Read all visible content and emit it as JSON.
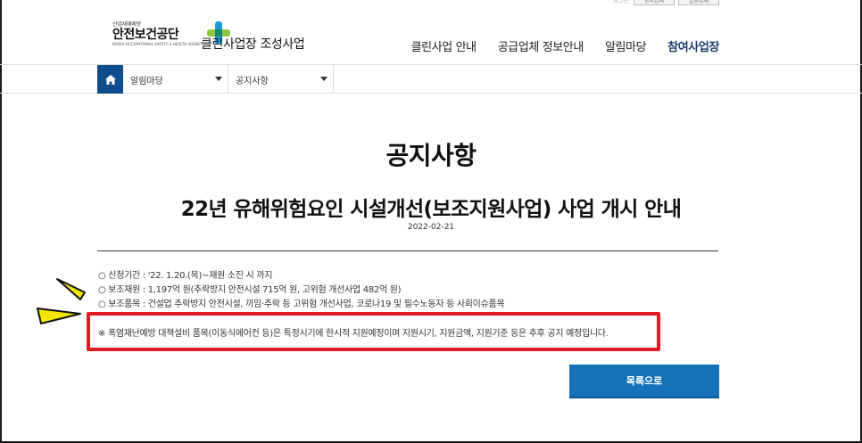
{
  "top_util": {
    "items": [
      "공지업체",
      "알림업체"
    ],
    "dim": "로그인"
  },
  "header": {
    "logo_small": "산업재해예방",
    "logo_big": "안전보건공단",
    "logo_eng": "KOREA OCCUPATIONAL SAFETY & HEALTH AGENCY",
    "site_name": "클린사업장 조성사업"
  },
  "gnb": {
    "items": [
      "클린사업 안내",
      "공급업체 정보안내",
      "알림마당",
      "참여사업장"
    ]
  },
  "breadcrumb": {
    "level1": "알림마당",
    "level2": "공지사항"
  },
  "page": {
    "title": "공지사항"
  },
  "post": {
    "title": "22년 유해위험요인 시설개선(보조지원사업) 사업 개시 안내",
    "date": "2022-02-21",
    "lines": [
      "○ 신청기간 : '22. 1.20.(목)~재원 소진 시 까지",
      "○ 보조재원 : 1,197억 원(추락방지 안전시설 715억 원, 고위험 개선사업 482억 원)",
      "○ 보조품목 : 건설업 추락방지 안전시설, 끼임·추락 등 고위험 개선사업, 코로나19 및 필수노동자 등 사회이슈품목"
    ],
    "notice": "※ 폭염재난예방 대책설비 품목(이동식에어컨 등)은 특정시기에 한시적 지원예정이며 지원시기, 지원금액, 지원기준 등은 추후 공지 예정입니다."
  },
  "buttons": {
    "list": "목록으로"
  },
  "colors": {
    "primary": "#1672b8",
    "home": "#0f4c8c",
    "highlight": "#e31b23",
    "accent_yellow": "#f2e600"
  }
}
